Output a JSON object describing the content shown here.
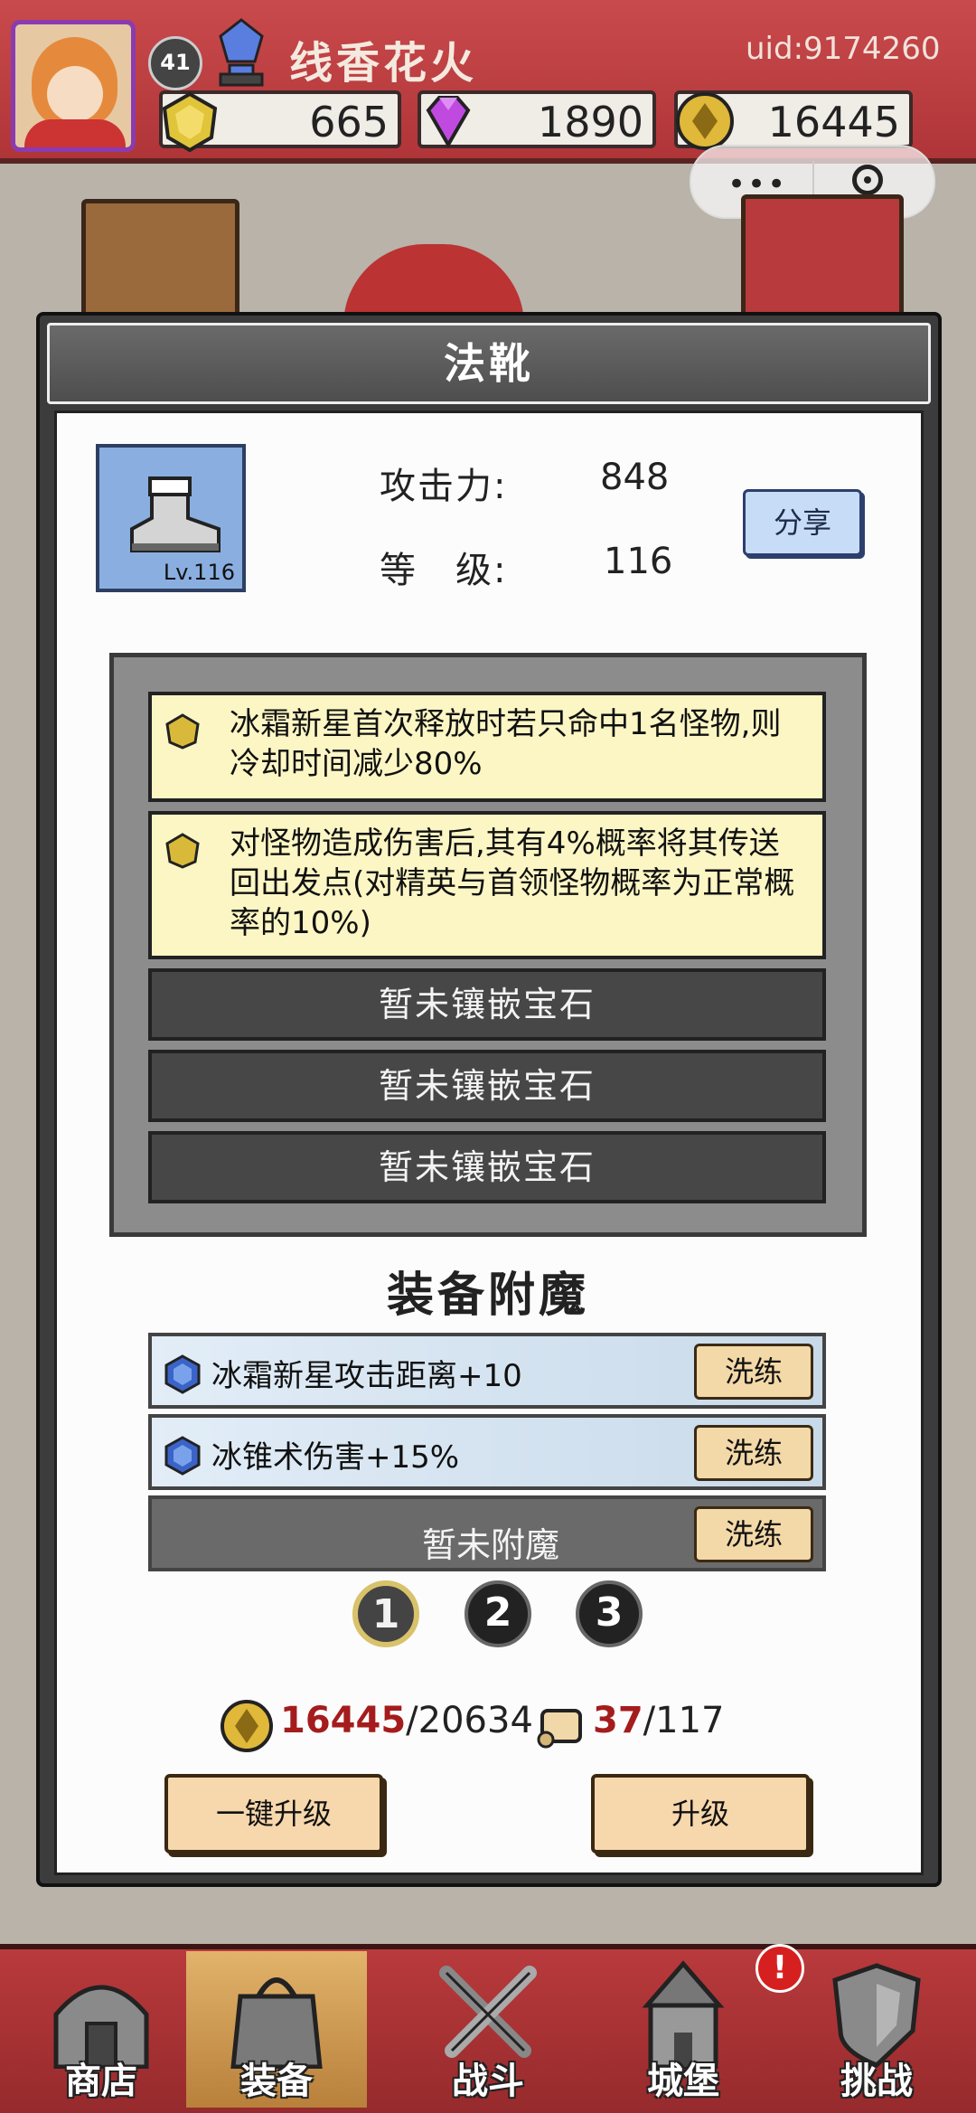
{
  "header": {
    "player_level": "41",
    "player_name": "线香花火",
    "uid": "uid:9174260",
    "resources": [
      {
        "icon": "gold-gem-icon",
        "value": "665"
      },
      {
        "icon": "diamond-icon",
        "value": "1890"
      },
      {
        "icon": "coin-icon",
        "value": "16445"
      }
    ]
  },
  "capsule": {
    "more": "•••",
    "close_icon": "target-ring-icon"
  },
  "dialog": {
    "title": "法靴",
    "item_level": "Lv.116",
    "attack_label": "攻击力:",
    "attack_value": "848",
    "level_label": "等　级:",
    "level_value": "116",
    "share_label": "分享"
  },
  "gems": {
    "filled": [
      {
        "text": "冰霜新星首次释放时若只命中1名怪物,则冷却时间减少80%"
      },
      {
        "text": "对怪物造成伤害后,其有4%概率将其传送回出发点(对精英与首领怪物概率为正常概率的10%)"
      }
    ],
    "empty_label": "暂未镶嵌宝石"
  },
  "enchant": {
    "title": "装备附魔",
    "rows": [
      {
        "text": "冰霜新星攻击距离+10",
        "button": "洗练"
      },
      {
        "text": "冰锥术伤害+15%",
        "button": "洗练"
      },
      {
        "text": "暂未附魔",
        "button": "洗练"
      }
    ],
    "pages": [
      "1",
      "2",
      "3"
    ]
  },
  "cost": {
    "coins_have": "16445",
    "coins_need": "/20634",
    "scrolls_have": "37",
    "scrolls_need": "/117"
  },
  "buttons": {
    "one_click_upgrade": "一键升级",
    "upgrade": "升级"
  },
  "nav": {
    "items": [
      {
        "label": "商店",
        "icon": "shop-icon"
      },
      {
        "label": "装备",
        "icon": "bag-icon"
      },
      {
        "label": "战斗",
        "icon": "swords-icon"
      },
      {
        "label": "城堡",
        "icon": "castle-icon"
      },
      {
        "label": "挑战",
        "icon": "shield-icon"
      }
    ],
    "alert": "!"
  },
  "colors": {
    "accent_red": "#b03538",
    "panel_dark": "#3c3c3c",
    "gem_yellow": "#fcf6c4",
    "button_tan": "#f7d7ac"
  }
}
